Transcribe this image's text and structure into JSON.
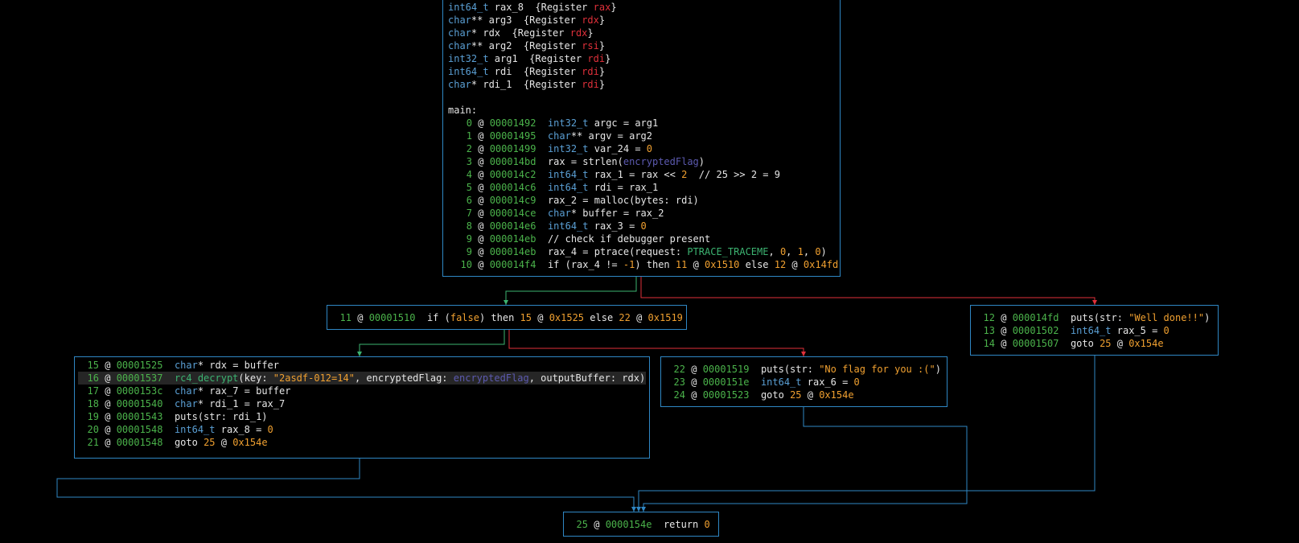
{
  "vars_header": [
    [
      [
        "int64_t",
        "kw"
      ],
      [
        " rax_8  {Register ",
        "t"
      ],
      [
        "rax",
        "reg"
      ],
      [
        "}",
        "t"
      ]
    ],
    [
      [
        "char",
        "kw"
      ],
      [
        "** arg3  {Register ",
        "t"
      ],
      [
        "rdx",
        "reg"
      ],
      [
        "}",
        "t"
      ]
    ],
    [
      [
        "char",
        "kw"
      ],
      [
        "* rdx  {Register ",
        "t"
      ],
      [
        "rdx",
        "reg"
      ],
      [
        "}",
        "t"
      ]
    ],
    [
      [
        "char",
        "kw"
      ],
      [
        "** arg2  {Register ",
        "t"
      ],
      [
        "rsi",
        "reg"
      ],
      [
        "}",
        "t"
      ]
    ],
    [
      [
        "int32_t",
        "kw"
      ],
      [
        " arg1  {Register ",
        "t"
      ],
      [
        "rdi",
        "reg"
      ],
      [
        "}",
        "t"
      ]
    ],
    [
      [
        "int64_t",
        "kw"
      ],
      [
        " rdi  {Register ",
        "t"
      ],
      [
        "rdi",
        "reg"
      ],
      [
        "}",
        "t"
      ]
    ],
    [
      [
        "char",
        "kw"
      ],
      [
        "* rdi_1  {Register ",
        "t"
      ],
      [
        "rdi",
        "reg"
      ],
      [
        "}",
        "t"
      ]
    ],
    [],
    [
      [
        "main:",
        "t"
      ]
    ]
  ],
  "blocks": {
    "main": {
      "lines": [
        {
          "idx": "0",
          "addr": "00001492",
          "code": [
            [
              "int32_t",
              "kw"
            ],
            [
              " argc = arg1",
              "t"
            ]
          ]
        },
        {
          "idx": "1",
          "addr": "00001495",
          "code": [
            [
              "char",
              "kw"
            ],
            [
              "** argv = arg2",
              "t"
            ]
          ]
        },
        {
          "idx": "2",
          "addr": "00001499",
          "code": [
            [
              "int32_t",
              "kw"
            ],
            [
              " var_24 = ",
              "t"
            ],
            [
              "0",
              "num"
            ]
          ]
        },
        {
          "idx": "3",
          "addr": "000014bd",
          "code": [
            [
              "rax = strlen(",
              "t"
            ],
            [
              "encryptedFlag",
              "sym"
            ],
            [
              ")",
              "t"
            ]
          ]
        },
        {
          "idx": "4",
          "addr": "000014c2",
          "code": [
            [
              "int64_t",
              "kw"
            ],
            [
              " rax_1 = rax << ",
              "t"
            ],
            [
              "2",
              "num"
            ],
            [
              "  // 25 >> 2 = 9",
              "t"
            ]
          ]
        },
        {
          "idx": "5",
          "addr": "000014c6",
          "code": [
            [
              "int64_t",
              "kw"
            ],
            [
              " rdi = rax_1",
              "t"
            ]
          ]
        },
        {
          "idx": "6",
          "addr": "000014c9",
          "code": [
            [
              "rax_2 = malloc(bytes: rdi)",
              "t"
            ]
          ]
        },
        {
          "idx": "7",
          "addr": "000014ce",
          "code": [
            [
              "char",
              "kw"
            ],
            [
              "* buffer = rax_2",
              "t"
            ]
          ]
        },
        {
          "idx": "8",
          "addr": "000014e6",
          "code": [
            [
              "int64_t",
              "kw"
            ],
            [
              " rax_3 = ",
              "t"
            ],
            [
              "0",
              "num"
            ]
          ]
        },
        {
          "idx": "9",
          "addr": "000014eb",
          "code": [
            [
              "// check if debugger present",
              "t"
            ]
          ]
        },
        {
          "idx": "9",
          "addr": "000014eb",
          "code": [
            [
              "rax_4 = ptrace(request: ",
              "t"
            ],
            [
              "PTRACE_TRACEME",
              "fn"
            ],
            [
              ", ",
              "t"
            ],
            [
              "0",
              "num"
            ],
            [
              ", ",
              "t"
            ],
            [
              "1",
              "num"
            ],
            [
              ", ",
              "t"
            ],
            [
              "0",
              "num"
            ],
            [
              ")",
              "t"
            ]
          ]
        },
        {
          "idx": "10",
          "addr": "000014f4",
          "code": [
            [
              "if (rax_4 != ",
              "t"
            ],
            [
              "-1",
              "num"
            ],
            [
              ") then ",
              "t"
            ],
            [
              "11",
              "num"
            ],
            [
              " @ ",
              "t"
            ],
            [
              "0x1510",
              "num"
            ],
            [
              " else ",
              "t"
            ],
            [
              "12",
              "num"
            ],
            [
              " @ ",
              "t"
            ],
            [
              "0x14fd",
              "num"
            ]
          ]
        }
      ]
    },
    "b11": {
      "lines": [
        {
          "idx": "11",
          "addr": "00001510",
          "code": [
            [
              "if (",
              "t"
            ],
            [
              "false",
              "num"
            ],
            [
              ") then ",
              "t"
            ],
            [
              "15",
              "num"
            ],
            [
              " @ ",
              "t"
            ],
            [
              "0x1525",
              "num"
            ],
            [
              " else ",
              "t"
            ],
            [
              "22",
              "num"
            ],
            [
              " @ ",
              "t"
            ],
            [
              "0x1519",
              "num"
            ]
          ]
        }
      ]
    },
    "b12": {
      "lines": [
        {
          "idx": "12",
          "addr": "000014fd",
          "code": [
            [
              "puts(str: ",
              "t"
            ],
            [
              "\"Well done!!\"",
              "str"
            ],
            [
              ")",
              "t"
            ]
          ]
        },
        {
          "idx": "13",
          "addr": "00001502",
          "code": [
            [
              "int64_t",
              "kw"
            ],
            [
              " rax_5 = ",
              "t"
            ],
            [
              "0",
              "num"
            ]
          ]
        },
        {
          "idx": "14",
          "addr": "00001507",
          "code": [
            [
              "goto ",
              "t"
            ],
            [
              "25",
              "num"
            ],
            [
              " @ ",
              "t"
            ],
            [
              "0x154e",
              "num"
            ]
          ]
        }
      ]
    },
    "b15": {
      "lines": [
        {
          "idx": "15",
          "addr": "00001525",
          "code": [
            [
              "char",
              "kw"
            ],
            [
              "* rdx = buffer",
              "t"
            ]
          ]
        },
        {
          "idx": "16",
          "addr": "00001537",
          "code": [
            [
              "rc4_decrypt",
              "fn"
            ],
            [
              "(key: ",
              "t"
            ],
            [
              "\"2asdf-012=14\"",
              "str"
            ],
            [
              ", encryptedFlag: ",
              "t"
            ],
            [
              "encryptedFlag",
              "sym"
            ],
            [
              ", outputBuffer: ",
              "t"
            ],
            [
              "rdx",
              "t"
            ],
            [
              ")",
              "t"
            ]
          ]
        },
        {
          "idx": "17",
          "addr": "0000153c",
          "code": [
            [
              "char",
              "kw"
            ],
            [
              "* rax_7 = buffer",
              "t"
            ]
          ]
        },
        {
          "idx": "18",
          "addr": "00001540",
          "code": [
            [
              "char",
              "kw"
            ],
            [
              "* rdi_1 = rax_7",
              "t"
            ]
          ]
        },
        {
          "idx": "19",
          "addr": "00001543",
          "code": [
            [
              "puts(str: rdi_1)",
              "t"
            ]
          ]
        },
        {
          "idx": "20",
          "addr": "00001548",
          "code": [
            [
              "int64_t",
              "kw"
            ],
            [
              " rax_8 = ",
              "t"
            ],
            [
              "0",
              "num"
            ]
          ]
        },
        {
          "idx": "21",
          "addr": "00001548",
          "code": [
            [
              "goto ",
              "t"
            ],
            [
              "25",
              "num"
            ],
            [
              " @ ",
              "t"
            ],
            [
              "0x154e",
              "num"
            ]
          ]
        }
      ]
    },
    "b22": {
      "lines": [
        {
          "idx": "22",
          "addr": "00001519",
          "code": [
            [
              "puts(str: ",
              "t"
            ],
            [
              "\"No flag for you :(\"",
              "str"
            ],
            [
              ")",
              "t"
            ]
          ]
        },
        {
          "idx": "23",
          "addr": "0000151e",
          "code": [
            [
              "int64_t",
              "kw"
            ],
            [
              " rax_6 = ",
              "t"
            ],
            [
              "0",
              "num"
            ]
          ]
        },
        {
          "idx": "24",
          "addr": "00001523",
          "code": [
            [
              "goto ",
              "t"
            ],
            [
              "25",
              "num"
            ],
            [
              " @ ",
              "t"
            ],
            [
              "0x154e",
              "num"
            ]
          ]
        }
      ]
    },
    "b25": {
      "lines": [
        {
          "idx": "25",
          "addr": "0000154e",
          "code": [
            [
              "return ",
              "t"
            ],
            [
              "0",
              "num"
            ]
          ]
        }
      ]
    }
  },
  "colors": {
    "edge_true": "#3cb371",
    "edge_false": "#e0303a",
    "edge_uncond": "#2f87c4",
    "block_border": "#2f87c4"
  }
}
